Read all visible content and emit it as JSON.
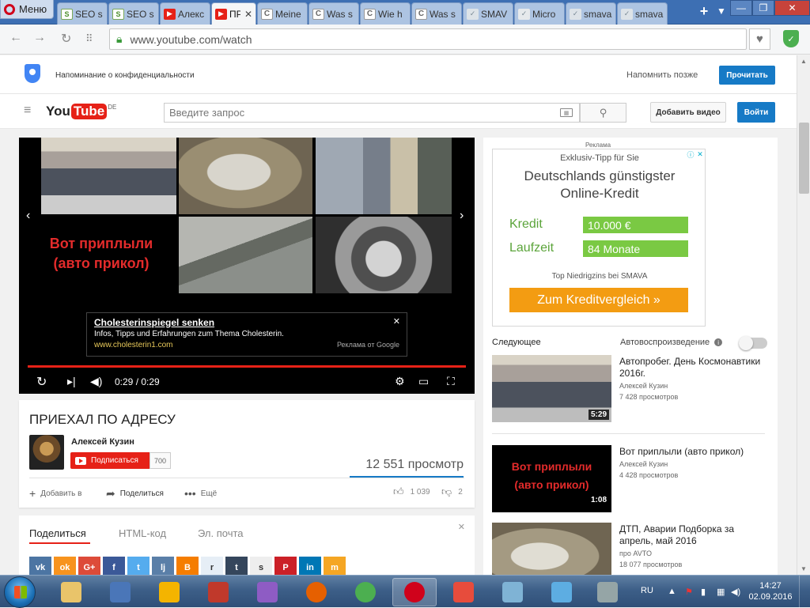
{
  "browser": {
    "menu_label": "Меню",
    "tabs": [
      {
        "label": "SEO s",
        "icon": "seo-icon",
        "kind": "seo"
      },
      {
        "label": "SEO s",
        "icon": "seo-icon",
        "kind": "seo"
      },
      {
        "label": "Алекс",
        "icon": "youtube-icon",
        "kind": "yt"
      },
      {
        "label": "ПР",
        "icon": "youtube-icon",
        "kind": "yt",
        "active": true
      },
      {
        "label": "Meine",
        "icon": "wiki-icon",
        "kind": "wiki"
      },
      {
        "label": "Was s",
        "icon": "wiki-icon",
        "kind": "wiki"
      },
      {
        "label": "Wie h",
        "icon": "wiki-icon",
        "kind": "wiki"
      },
      {
        "label": "Was s",
        "icon": "wiki-icon",
        "kind": "wiki"
      },
      {
        "label": "SMAV",
        "icon": "smava-icon",
        "kind": "smava"
      },
      {
        "label": "Micro",
        "icon": "microsoft-icon",
        "kind": "ms"
      },
      {
        "label": "smava",
        "icon": "smava-icon",
        "kind": "smava"
      },
      {
        "label": "smava",
        "icon": "smava-icon",
        "kind": "smava"
      }
    ],
    "url": "www.youtube.com/watch"
  },
  "privacy": {
    "text": "Напоминание о конфиденциальности",
    "later": "Напомнить позже",
    "read": "Прочитать"
  },
  "masthead": {
    "logo_you": "You",
    "logo_tube": "Tube",
    "logo_region": "DE",
    "search_placeholder": "Введите запрос",
    "upload": "Добавить видео",
    "signin": "Войти"
  },
  "player": {
    "overlay_title_line1": "Вот приплыли",
    "overlay_title_line2": "(авто прикол)",
    "ad": {
      "title": "Cholesterinspiegel senken",
      "description": "Infos, Tipps und Erfahrungen zum Thema Cholesterin.",
      "url": "www.cholesterin1.com",
      "source": "Реклама от Google"
    },
    "time": "0:29 / 0:29",
    "progress": 1.0
  },
  "video": {
    "title": "ПРИЕХАЛ ПО АДРЕСУ",
    "channel": "Алексей Кузин",
    "subscribe": "Подписаться",
    "subscribers": "700",
    "views": "12 551 просмотр",
    "add_to": "Добавить в",
    "share": "Поделиться",
    "more": "Ещё",
    "likes": "1 039",
    "dislikes": "2"
  },
  "share_panel": {
    "tabs": [
      "Поделиться",
      "HTML-код",
      "Эл. почта"
    ],
    "networks": [
      {
        "name": "vk",
        "label": "vk",
        "color": "#4c75a3"
      },
      {
        "name": "odnoklassniki",
        "label": "ok",
        "color": "#f7931e"
      },
      {
        "name": "google-plus",
        "label": "G+",
        "color": "#dd4b39"
      },
      {
        "name": "facebook",
        "label": "f",
        "color": "#3b5998"
      },
      {
        "name": "twitter",
        "label": "t",
        "color": "#55acee"
      },
      {
        "name": "livejournal",
        "label": "lj",
        "color": "#5a7fa8"
      },
      {
        "name": "blogger",
        "label": "B",
        "color": "#f57d00"
      },
      {
        "name": "reddit",
        "label": "r",
        "color": "#e6eef6"
      },
      {
        "name": "tumblr",
        "label": "t",
        "color": "#35465c"
      },
      {
        "name": "stumbleupon",
        "label": "s",
        "color": "#eeeeee"
      },
      {
        "name": "pinterest",
        "label": "P",
        "color": "#cb2027"
      },
      {
        "name": "linkedin",
        "label": "in",
        "color": "#0077b5"
      },
      {
        "name": "mailru",
        "label": "m",
        "color": "#f5a623"
      }
    ]
  },
  "sidebar": {
    "ad_label": "Реклама",
    "banner": {
      "line1": "Exklusiv-Tipp für Sie",
      "line2": "Deutschlands günstigster",
      "line3": "Online-Kredit",
      "credit_label": "Kredit",
      "credit_value": "10.000 €",
      "term_label": "Laufzeit",
      "term_value": "84 Monate",
      "footer": "Top Niedrigzins bei SMAVA",
      "cta": "Zum Kreditvergleich »"
    },
    "up_next": "Следующее",
    "autoplay": "Автовоспроизведение",
    "autoplay_info": "i",
    "videos": [
      {
        "title": "Автопробег. День Космонавтики 2016г.",
        "channel": "Алексей Кузин",
        "views": "7 428 просмотров",
        "duration": "5:29"
      },
      {
        "title": "Вот приплыли (авто прикол)",
        "channel": "Алексей Кузин",
        "views": "4 428 просмотров",
        "duration": "1:08",
        "thumb_line1": "Вот приплыли",
        "thumb_line2": "(авто прикол)"
      },
      {
        "title": "ДТП, Аварии Подборка за апрель, май 2016",
        "channel": "про AVTO",
        "views": "18 077 просмотров"
      }
    ]
  },
  "taskbar": {
    "apps": [
      "explorer-icon",
      "shield-app-icon",
      "warning-app-icon",
      "rubik-icon",
      "feather-icon",
      "firefox-icon",
      "chrome-icon",
      "opera-icon",
      "ccleaner-icon",
      "notepad-icon",
      "arrows-app-icon",
      "speaker-app-icon"
    ],
    "active_app": "opera-icon",
    "lang": "RU",
    "time": "14:27",
    "date": "02.09.2016"
  }
}
